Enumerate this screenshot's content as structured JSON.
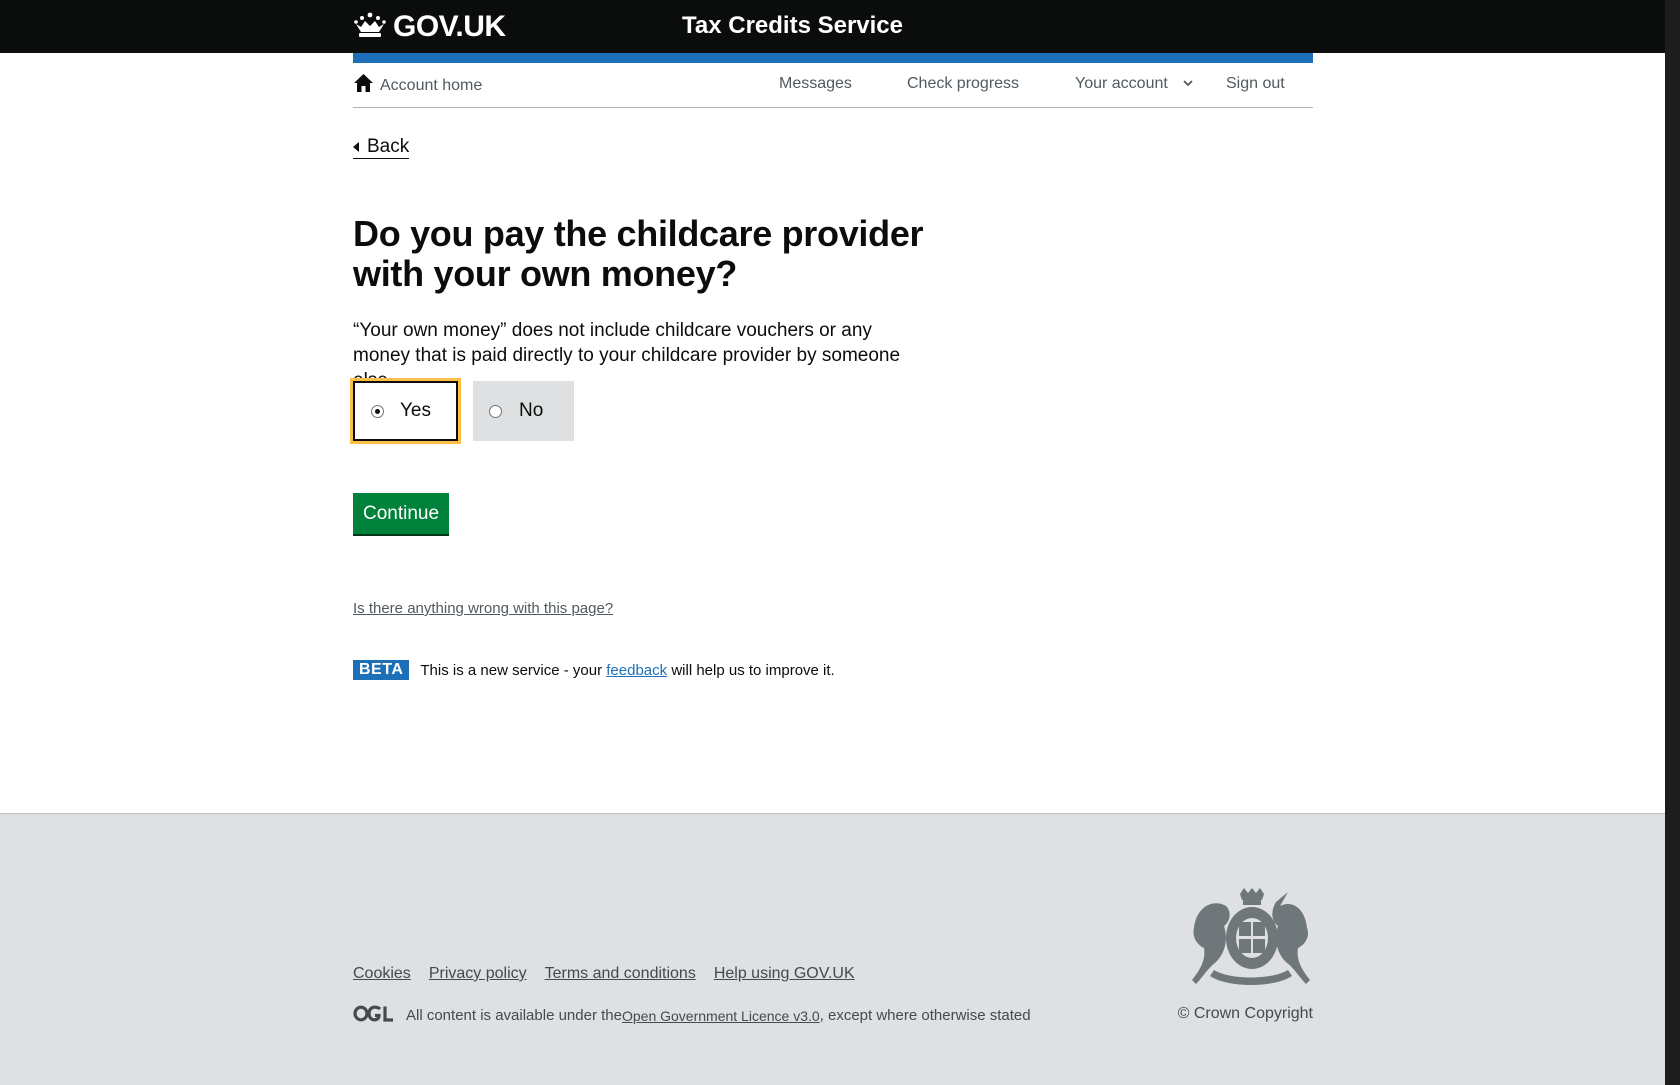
{
  "header": {
    "logo_text": "GOV.UK",
    "service_name": "Tax Credits Service"
  },
  "nav": {
    "home": "Account home",
    "messages": "Messages",
    "check_progress": "Check progress",
    "your_account": "Your account",
    "sign_out": "Sign out"
  },
  "back_label": "Back",
  "question": {
    "title": "Do you pay the childcare provider with your own money?",
    "hint": "“Your own money” does not include childcare vouchers or any money that is paid directly to your childcare provider by someone else.",
    "options": [
      {
        "label": "Yes",
        "selected": true
      },
      {
        "label": "No",
        "selected": false
      }
    ]
  },
  "continue_label": "Continue",
  "report_link": "Is there anything wrong with this page?",
  "beta": {
    "tag": "BETA",
    "text_before": "This is a new service  - your ",
    "link": "feedback",
    "text_after": " will help us to improve it."
  },
  "footer": {
    "links": [
      "Cookies",
      "Privacy policy",
      "Terms and conditions",
      "Help using GOV.UK"
    ],
    "licence_before": "All content is available under the ",
    "licence_link": "Open Government Licence v3.0",
    "licence_after": ", except where otherwise stated",
    "copyright": "© Crown Copyright"
  },
  "colors": {
    "header_bg": "#0b0c0c",
    "brand_blue": "#1d70b8",
    "button_green": "#00823b",
    "focus_yellow": "#ffbf47",
    "footer_bg": "#dee0e2"
  },
  "icons": {
    "logo": "crown-icon",
    "home": "home-icon",
    "account_menu": "chevron-down-icon",
    "licence": "ogl-logo",
    "footer_crest": "royal-coat-of-arms"
  }
}
